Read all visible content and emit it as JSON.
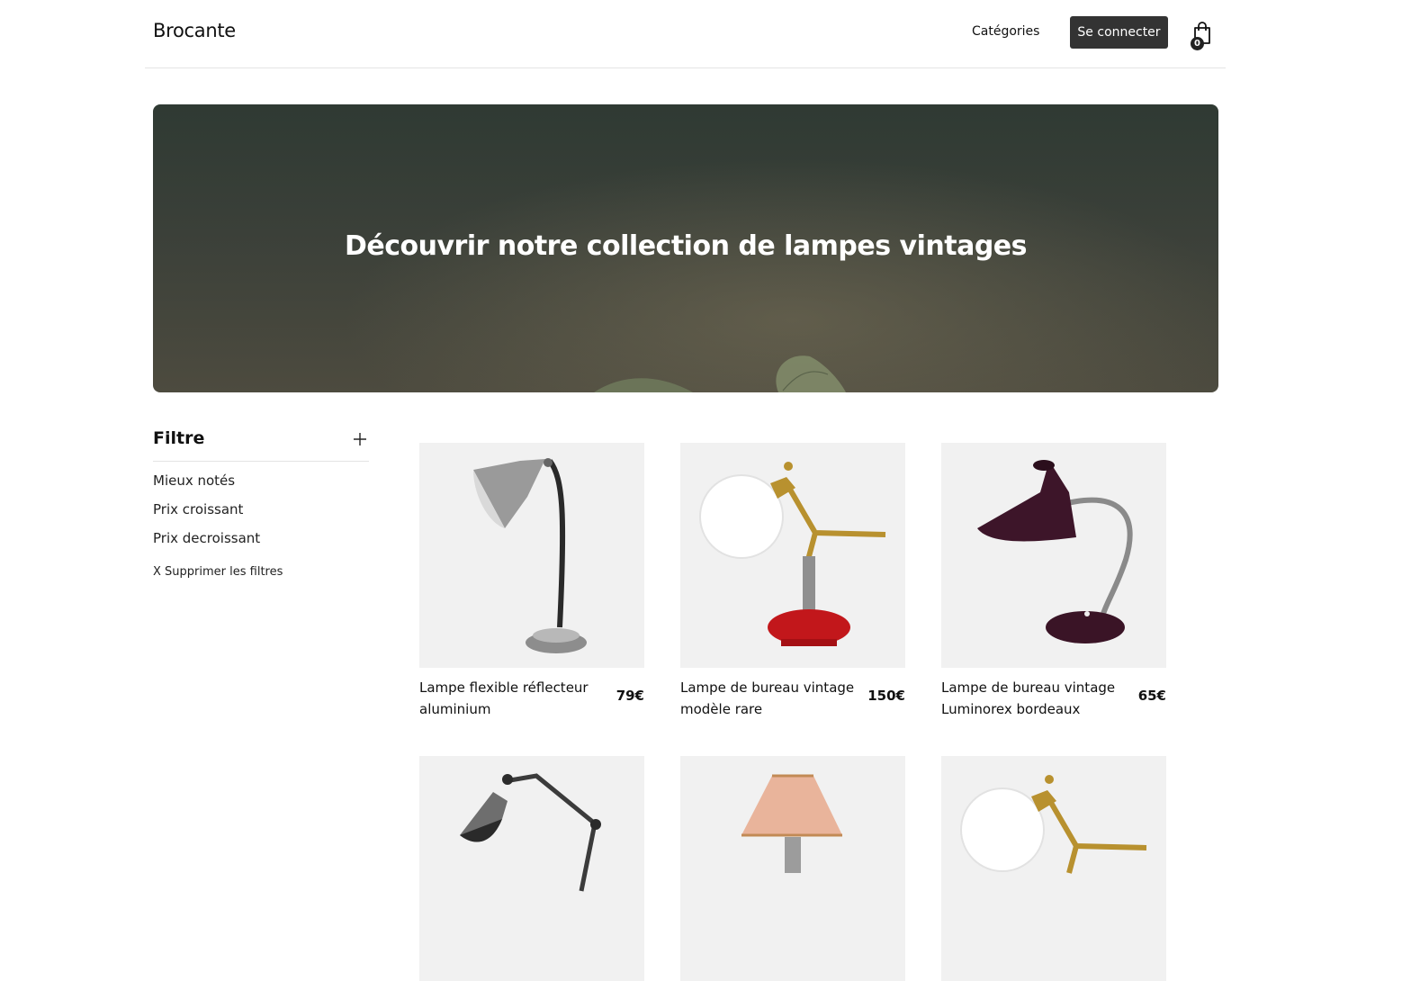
{
  "header": {
    "brand": "Brocante",
    "nav_categories": "Catégories",
    "login_label": "Se connecter",
    "cart_count": "0"
  },
  "hero": {
    "title": "Découvrir notre collection de lampes vintages"
  },
  "filter": {
    "title": "Filtre",
    "options": [
      "Mieux notés",
      "Prix croissant",
      "Prix decroissant"
    ],
    "clear_label": "X Supprimer les filtres"
  },
  "products": [
    {
      "name": "Lampe flexible réflecteur aluminium",
      "price": "79€",
      "image": "silver-gooseneck-lamp"
    },
    {
      "name": "Lampe de bureau vintage modèle rare",
      "price": "150€",
      "image": "white-globe-brass-lamp"
    },
    {
      "name": "Lampe de bureau vintage Luminorex bordeaux",
      "price": "65€",
      "image": "burgundy-desk-lamp"
    },
    {
      "name": "",
      "price": "",
      "image": "articulated-chrome-lamp"
    },
    {
      "name": "",
      "price": "",
      "image": "pink-shade-lamp"
    },
    {
      "name": "",
      "price": "",
      "image": "white-globe-brass-lamp"
    }
  ],
  "colors": {
    "login_bg": "#333333",
    "hero_dark": "#2f3a33",
    "card_bg": "#f1f1f1"
  }
}
